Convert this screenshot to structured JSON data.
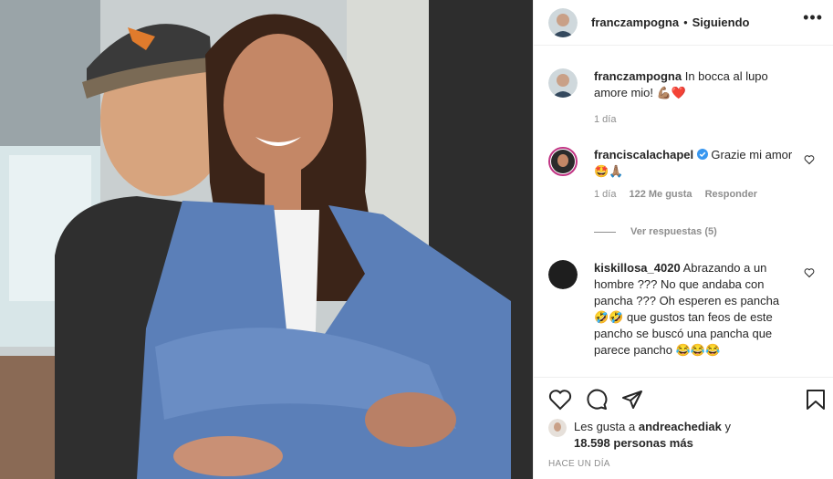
{
  "post": {
    "author": "franczampogna",
    "follow_status": "Siguiendo",
    "more_label": "•••"
  },
  "comments": [
    {
      "username": "franczampogna",
      "text": "In bocca al lupo amore mio! 💪🏽❤️",
      "time": "1 día"
    },
    {
      "username": "franciscalachapel",
      "verified": true,
      "text": "Grazie mi amor 🤩🙏🏽",
      "time": "1 día",
      "likes": "122 Me gusta",
      "reply_label": "Responder",
      "view_replies": "Ver respuestas (5)"
    },
    {
      "username": "kiskillosa_4020",
      "text": "Abrazando a un hombre ??? No que andaba con pancha ??? Oh esperen es pancha 🤣🤣 que gustos tan feos de este pancho se buscó una pancha que parece pancho 😂😂😂"
    }
  ],
  "likes": {
    "prefix": "Les gusta a",
    "user": "andreachediak",
    "conj": "y",
    "count": "18.598 personas más"
  },
  "timestamp": "HACE UN DÍA",
  "icons": [
    "heart-icon",
    "comment-icon",
    "share-icon",
    "bookmark-icon",
    "verified-icon"
  ],
  "colors": {
    "verified": "#3897f0",
    "muted": "#8e8e8e",
    "text": "#262626"
  }
}
